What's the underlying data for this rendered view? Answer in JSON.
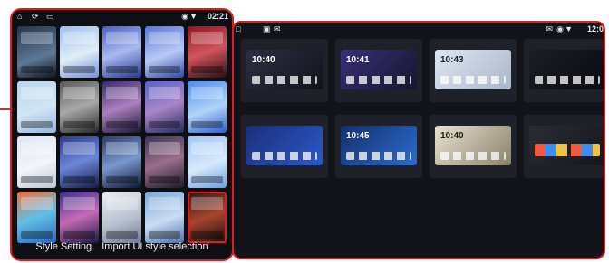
{
  "left_panel": {
    "status_time": "02:21",
    "status_icons": [
      "home-icon",
      "rotate-icon",
      "window-icon",
      "location-icon",
      "wifi-icon"
    ],
    "thumbnail_count": 20,
    "caption": {
      "style_setting": "Style Setting",
      "import_ui": "Import UI style selection"
    }
  },
  "right_panel": {
    "status_time": "12:0",
    "previews": [
      {
        "clock": "10:40"
      },
      {
        "clock": "10:41"
      },
      {
        "clock": "10:43"
      },
      {
        "clock": ""
      },
      {
        "clock": ""
      },
      {
        "clock": "10:45"
      },
      {
        "clock": "10:40"
      },
      {
        "clock": ""
      }
    ]
  },
  "colors": {
    "highlight_border": "#e01b22",
    "panel_bg": "#0d0f14"
  }
}
